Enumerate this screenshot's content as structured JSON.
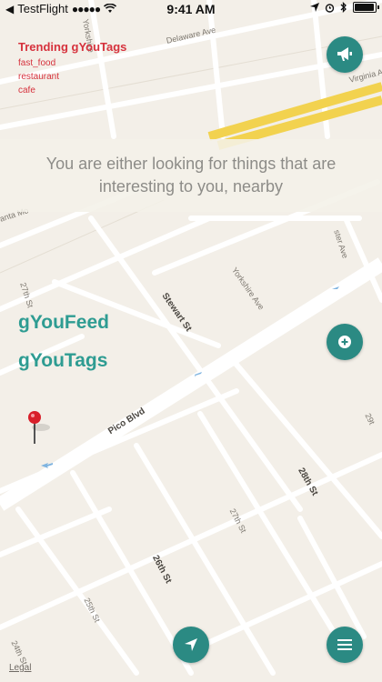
{
  "status_bar": {
    "carrier": "TestFlight",
    "time": "9:41 AM"
  },
  "map": {
    "streets": {
      "delaware_ave": "Delaware Ave",
      "yorkshire_ave_top": "Yorkshire",
      "virginia_ave": "Virginia A",
      "santa_mo": "anta Mo",
      "chester_ave": "ster Ave",
      "street_27th": "27th St",
      "stewart_st": "Stewart St",
      "yorkshire_ave": "Yorkshire Ave",
      "pico_blvd": "Pico Blvd",
      "street_28th": "28th St",
      "street_27th_lower": "27th St",
      "street_26th": "26th St",
      "street_25th": "25th St",
      "street_24th": "24th St",
      "street_29th": "29t"
    },
    "legal": "Legal",
    "road_color": "#ffffff",
    "freeway_color": "#f2d24f",
    "pin_color": "#d81f2a"
  },
  "trending": {
    "title": "Trending gYouTags",
    "tags": [
      "fast_food",
      "restaurant",
      "cafe"
    ]
  },
  "banner": {
    "line1": "You are either looking for things that are",
    "line2": "interesting to you, nearby"
  },
  "links": {
    "feed": "gYouFeed",
    "tags": "gYouTags"
  },
  "colors": {
    "accent": "#2b8a83",
    "link": "#2e9c92",
    "trending": "#d6323d"
  },
  "icons": {
    "announce": "megaphone-icon",
    "add": "plus-circle-icon",
    "locate": "navigation-arrow-icon",
    "menu": "hamburger-menu-icon"
  }
}
